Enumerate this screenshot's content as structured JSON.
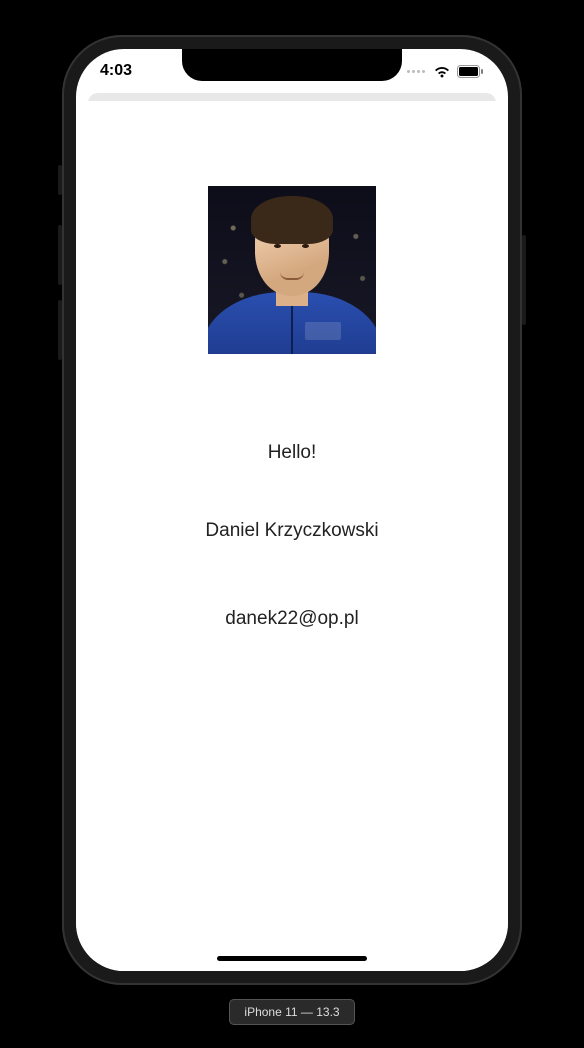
{
  "status_bar": {
    "time": "4:03"
  },
  "profile": {
    "greeting": "Hello!",
    "name": "Daniel Krzyczkowski",
    "email": "danek22@op.pl"
  },
  "simulator": {
    "label": "iPhone 11 — 13.3"
  }
}
